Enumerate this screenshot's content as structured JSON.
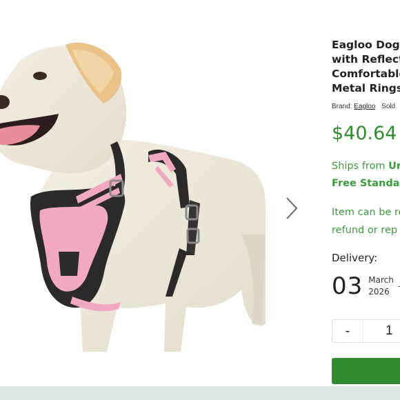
{
  "gallery": {
    "image_alt": "Pink reflective dog harness on a Labrador",
    "next_icon": "chevron-right-icon"
  },
  "product": {
    "title_lines": [
      "Eagloo Dog H",
      "with Reflectiv",
      "Comfortable",
      "Metal Rings, I"
    ],
    "brand_label": "Brand:",
    "brand_name": "Eagloo",
    "sold_label": "Sold",
    "price": "$40.64"
  },
  "shipping": {
    "ships_from_label": "Ships from",
    "ships_from_value": "Ur",
    "shipping_method": "Free Standar"
  },
  "returns": {
    "line1": "Item can be re",
    "line2": "refund or rep"
  },
  "delivery": {
    "label": "Delivery:",
    "day": "03",
    "month": "March",
    "year": "2026"
  },
  "quantity": {
    "minus_label": "-",
    "value": "1"
  },
  "colors": {
    "accent_green": "#2e8b2e",
    "text_green": "#3a9b3a",
    "harness_pink": "#f1a9c3",
    "bottom_band": "#dfe9ec"
  }
}
